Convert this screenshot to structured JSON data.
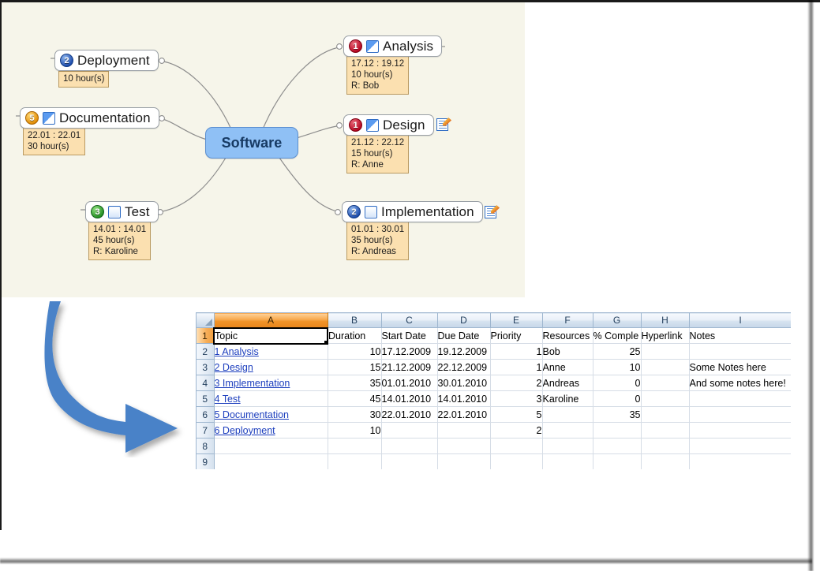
{
  "mindmap": {
    "central": {
      "label": "Software",
      "color": "#8fc0f5"
    },
    "nodes": [
      {
        "id": "analysis",
        "label": "Analysis",
        "priority": "1",
        "priority_class": "prio-1",
        "progress": "full",
        "has_note": false,
        "detail": {
          "dates": "17.12 : 19.12",
          "hours": "10 hour(s)",
          "resource": "R: Bob"
        }
      },
      {
        "id": "design",
        "label": "Design",
        "priority": "1",
        "priority_class": "prio-1",
        "progress": "full",
        "has_note": true,
        "detail": {
          "dates": "21.12 : 22.12",
          "hours": "15 hour(s)",
          "resource": "R: Anne"
        }
      },
      {
        "id": "implementation",
        "label": "Implementation",
        "priority": "2",
        "priority_class": "prio-2",
        "progress": "empty",
        "has_note": true,
        "detail": {
          "dates": "01.01 : 30.01",
          "hours": "35 hour(s)",
          "resource": "R: Andreas"
        }
      },
      {
        "id": "deployment",
        "label": "Deployment",
        "priority": "2",
        "priority_class": "prio-2",
        "progress": "none",
        "has_note": false,
        "detail": {
          "dates": "",
          "hours": "10 hour(s)",
          "resource": ""
        }
      },
      {
        "id": "documentation",
        "label": "Documentation",
        "priority": "5",
        "priority_class": "prio-5",
        "progress": "full",
        "has_note": false,
        "detail": {
          "dates": "22.01 : 22.01",
          "hours": "30 hour(s)",
          "resource": ""
        }
      },
      {
        "id": "test",
        "label": "Test",
        "priority": "3",
        "priority_class": "prio-3",
        "progress": "empty",
        "has_note": false,
        "detail": {
          "dates": "14.01 : 14.01",
          "hours": "45 hour(s)",
          "resource": "R: Karoline"
        }
      }
    ]
  },
  "arrow": {
    "color": "#4a82c8"
  },
  "spreadsheet": {
    "columns": [
      "A",
      "B",
      "C",
      "D",
      "E",
      "F",
      "G",
      "H",
      "I"
    ],
    "selected_column": "A",
    "active_cell": "A1",
    "row_numbers": [
      "1",
      "2",
      "3",
      "4",
      "5",
      "6",
      "7",
      "8",
      "9"
    ],
    "headers": [
      "Topic",
      "Duration",
      "Start Date",
      "Due Date",
      "Priority",
      "Resources",
      "% Comple",
      "Hyperlink",
      "Notes"
    ],
    "rows": [
      {
        "topic": "1 Analysis",
        "duration": "10",
        "start": "17.12.2009",
        "due": "19.12.2009",
        "priority": "1",
        "resources": "Bob",
        "percent": "25",
        "hyperlink": "",
        "notes": ""
      },
      {
        "topic": "2 Design",
        "duration": "15",
        "start": "21.12.2009",
        "due": "22.12.2009",
        "priority": "1",
        "resources": "Anne",
        "percent": "10",
        "hyperlink": "",
        "notes": "Some Notes here"
      },
      {
        "topic": "3 Implementation",
        "duration": "35",
        "start": "01.01.2010",
        "due": "30.01.2010",
        "priority": "2",
        "resources": "Andreas",
        "percent": "0",
        "hyperlink": "",
        "notes": "And some notes here!"
      },
      {
        "topic": "4 Test",
        "duration": "45",
        "start": "14.01.2010",
        "due": "14.01.2010",
        "priority": "3",
        "resources": "Karoline",
        "percent": "0",
        "hyperlink": "",
        "notes": ""
      },
      {
        "topic": "5 Documentation",
        "duration": "30",
        "start": "22.01.2010",
        "due": "22.01.2010",
        "priority": "5",
        "resources": "",
        "percent": "35",
        "hyperlink": "",
        "notes": ""
      },
      {
        "topic": "6 Deployment",
        "duration": "10",
        "start": "",
        "due": "",
        "priority": "2",
        "resources": "",
        "percent": "",
        "hyperlink": "",
        "notes": ""
      },
      {
        "topic": "",
        "duration": "",
        "start": "",
        "due": "",
        "priority": "",
        "resources": "",
        "percent": "",
        "hyperlink": "",
        "notes": ""
      },
      {
        "topic": "",
        "duration": "",
        "start": "",
        "due": "",
        "priority": "",
        "resources": "",
        "percent": "",
        "hyperlink": "",
        "notes": ""
      }
    ]
  }
}
